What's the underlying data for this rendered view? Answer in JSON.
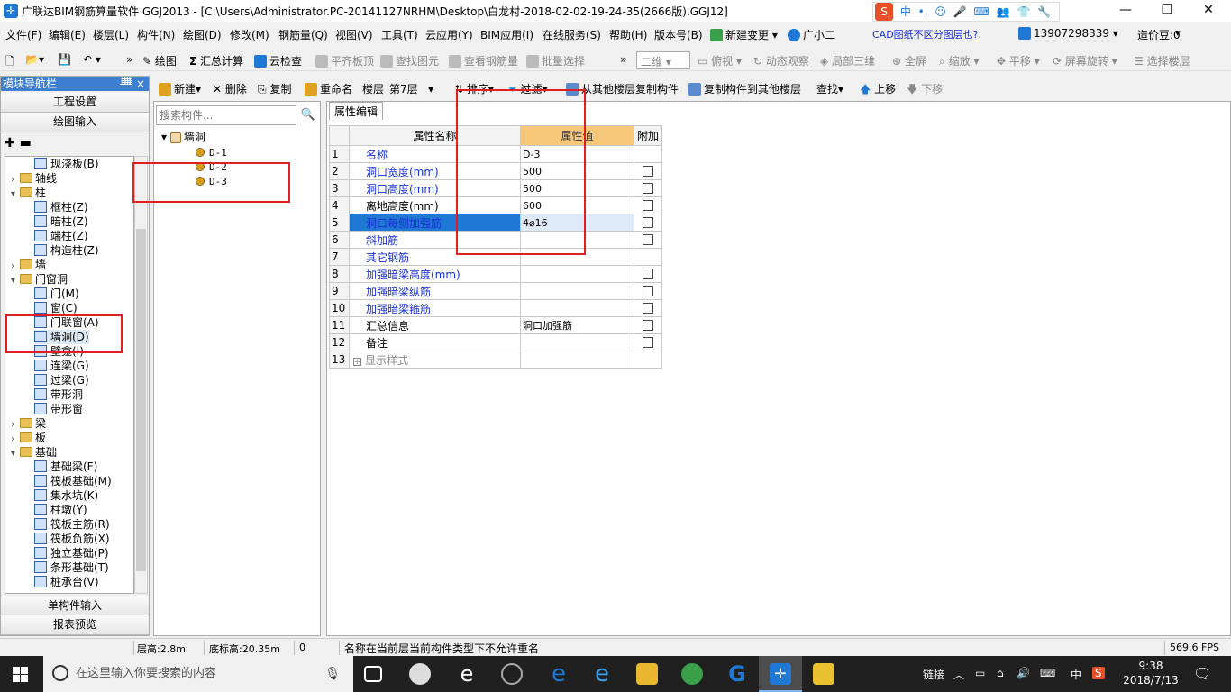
{
  "window": {
    "title": "广联达BIM钢筋算量软件 GGJ2013 - [C:\\Users\\Administrator.PC-20141127NRHM\\Desktop\\白龙村-2018-02-02-19-24-35(2666版).GGJ12]",
    "minimize": "—",
    "restore": "❐",
    "close": "✕"
  },
  "ime": {
    "logo": "S",
    "items": [
      "中",
      "•,",
      "☺",
      "🎤",
      "⌨",
      "👥",
      "👕",
      "🔧"
    ]
  },
  "menu": {
    "items": [
      "文件(F)",
      "编辑(E)",
      "楼层(L)",
      "构件(N)",
      "绘图(D)",
      "修改(M)",
      "钢筋量(Q)",
      "视图(V)",
      "工具(T)",
      "云应用(Y)",
      "BIM应用(I)",
      "在线服务(S)",
      "帮助(H)",
      "版本号(B)"
    ],
    "new_change": "新建变更",
    "assistant": "广小二",
    "cad_hint": "CAD图纸不区分图层也?.",
    "phone": "13907298339",
    "price_beans": "造价豆:0"
  },
  "toolbar1": {
    "draw": "绘图",
    "sum_calc": "汇总计算",
    "cloud_check": "云检查",
    "flush_slab_top": "平齐板顶",
    "find_element": "查找图元",
    "view_rebar": "查看钢筋量",
    "batch_select": "批量选择",
    "view_mode": "二维",
    "top_view": "俯视",
    "dynamic_observe": "动态观察",
    "local_3d": "局部三维",
    "fullscreen": "全屏",
    "zoom": "缩放",
    "pan": "平移",
    "screen_rotate": "屏幕旋转",
    "select_floor": "选择楼层"
  },
  "toolbar2": {
    "new": "新建",
    "delete": "删除",
    "copy": "复制",
    "rename": "重命名",
    "floor_label": "楼层",
    "floor_value": "第7层",
    "sort": "排序",
    "filter": "过滤",
    "copy_from_floor": "从其他楼层复制构件",
    "copy_to_floor": "复制构件到其他楼层",
    "find": "查找",
    "move_up": "上移",
    "move_down": "下移"
  },
  "nav": {
    "header": "模块导航栏",
    "pin": "ᚙ",
    "close": "×",
    "project_settings": "工程设置",
    "drawing_input": "绘图输入",
    "single_input": "单构件输入",
    "report_preview": "报表预览",
    "tree": [
      {
        "label": "现浇板(B)",
        "type": "leaf"
      },
      {
        "label": "轴线",
        "type": "folder-collapsed"
      },
      {
        "label": "柱",
        "type": "folder-open"
      },
      {
        "label": "框柱(Z)",
        "type": "leaf"
      },
      {
        "label": "暗柱(Z)",
        "type": "leaf"
      },
      {
        "label": "端柱(Z)",
        "type": "leaf"
      },
      {
        "label": "构造柱(Z)",
        "type": "leaf"
      },
      {
        "label": "墙",
        "type": "folder-collapsed"
      },
      {
        "label": "门窗洞",
        "type": "folder-open"
      },
      {
        "label": "门(M)",
        "type": "leaf"
      },
      {
        "label": "窗(C)",
        "type": "leaf"
      },
      {
        "label": "门联窗(A)",
        "type": "leaf"
      },
      {
        "label": "墙洞(D)",
        "type": "leaf-selected"
      },
      {
        "label": "壁龛(I)",
        "type": "leaf"
      },
      {
        "label": "连梁(G)",
        "type": "leaf"
      },
      {
        "label": "过梁(G)",
        "type": "leaf"
      },
      {
        "label": "带形洞",
        "type": "leaf"
      },
      {
        "label": "带形窗",
        "type": "leaf"
      },
      {
        "label": "梁",
        "type": "folder-collapsed"
      },
      {
        "label": "板",
        "type": "folder-collapsed"
      },
      {
        "label": "基础",
        "type": "folder-open"
      },
      {
        "label": "基础梁(F)",
        "type": "leaf"
      },
      {
        "label": "筏板基础(M)",
        "type": "leaf"
      },
      {
        "label": "集水坑(K)",
        "type": "leaf"
      },
      {
        "label": "柱墩(Y)",
        "type": "leaf"
      },
      {
        "label": "筏板主筋(R)",
        "type": "leaf"
      },
      {
        "label": "筏板负筋(X)",
        "type": "leaf"
      },
      {
        "label": "独立基础(P)",
        "type": "leaf"
      },
      {
        "label": "条形基础(T)",
        "type": "leaf"
      },
      {
        "label": "桩承台(V)",
        "type": "leaf"
      }
    ]
  },
  "components": {
    "search_placeholder": "搜索构件...",
    "root": "墙洞",
    "items": [
      "D-1",
      "D-2",
      "D-3"
    ],
    "selected": "D-3"
  },
  "props": {
    "tab": "属性编辑",
    "headers": [
      "属性名称",
      "属性值",
      "附加"
    ],
    "rows": [
      {
        "n": "1",
        "name": "名称",
        "value": "D-3",
        "blue": true,
        "cb": false
      },
      {
        "n": "2",
        "name": "洞口宽度(mm)",
        "value": "500",
        "blue": true,
        "cb": true
      },
      {
        "n": "3",
        "name": "洞口高度(mm)",
        "value": "500",
        "blue": true,
        "cb": true
      },
      {
        "n": "4",
        "name": "离地高度(mm)",
        "value": "600",
        "blue": false,
        "cb": true
      },
      {
        "n": "5",
        "name": "洞口每侧加强筋",
        "value": "4⌀16",
        "blue": true,
        "cb": true,
        "selected": true
      },
      {
        "n": "6",
        "name": "斜加筋",
        "value": "",
        "blue": true,
        "cb": true
      },
      {
        "n": "7",
        "name": "其它钢筋",
        "value": "",
        "blue": true,
        "cb": false
      },
      {
        "n": "8",
        "name": "加强暗梁高度(mm)",
        "value": "",
        "blue": true,
        "cb": true
      },
      {
        "n": "9",
        "name": "加强暗梁纵筋",
        "value": "",
        "blue": true,
        "cb": true
      },
      {
        "n": "10",
        "name": "加强暗梁箍筋",
        "value": "",
        "blue": true,
        "cb": true
      },
      {
        "n": "11",
        "name": "汇总信息",
        "value": "洞口加强筋",
        "blue": false,
        "cb": true
      },
      {
        "n": "12",
        "name": "备注",
        "value": "",
        "blue": false,
        "cb": true
      },
      {
        "n": "13",
        "name": "显示样式",
        "value": "",
        "blue": false,
        "cb": false,
        "expand": true
      }
    ]
  },
  "status": {
    "floor_height": "层高:2.8m",
    "bottom_elev": "底标高:20.35m",
    "count": "0",
    "message": "名称在当前层当前构件类型下不允许重名",
    "fps": "569.6 FPS"
  },
  "taskbar": {
    "search_placeholder": "在这里输入你要搜索的内容",
    "link": "链接",
    "lang": "中",
    "time": "9:38",
    "date": "2018/7/13"
  }
}
